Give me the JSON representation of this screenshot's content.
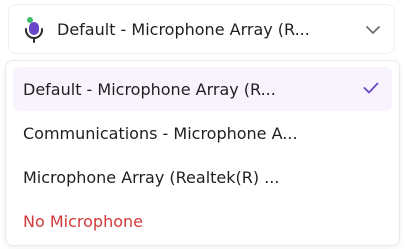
{
  "dropdown": {
    "selected_label": "Default - Microphone Array (R...",
    "icon": "microphone-icon",
    "chevron_icon": "chevron-down-icon"
  },
  "menu": {
    "items": [
      {
        "label": "Default - Microphone Array (R...",
        "selected": true
      },
      {
        "label": "Communications - Microphone A...",
        "selected": false
      },
      {
        "label": "Microphone Array (Realtek(R) ...",
        "selected": false
      },
      {
        "label": "No Microphone",
        "selected": false
      }
    ],
    "check_icon": "checkmark-icon"
  },
  "colors": {
    "accent": "#6a45c9",
    "selected_bg": "#f8f3fd",
    "danger": "#d23a3a",
    "mic_green": "#3bbf6a",
    "mic_purple": "#6a45c9"
  }
}
